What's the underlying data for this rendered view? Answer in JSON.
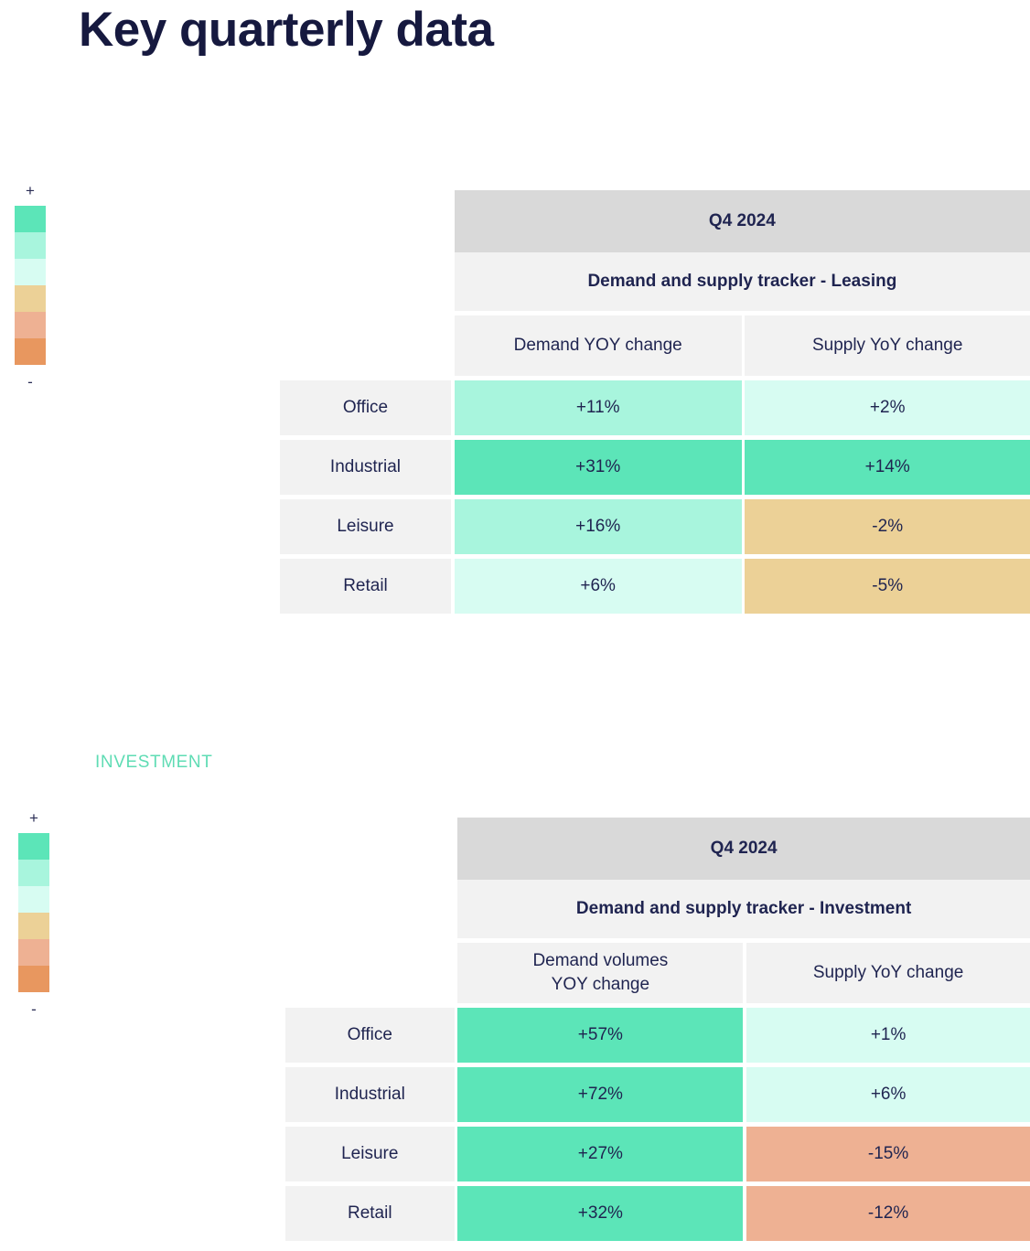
{
  "page": {
    "title": "Key quarterly data",
    "background_color": "#ffffff",
    "title_color": "#16193f"
  },
  "legend": {
    "high_label": "+",
    "low_label": "-",
    "colors": [
      "#5ce5b8",
      "#a8f5dd",
      "#d7fcf2",
      "#ecd197",
      "#eeb193",
      "#e8975f"
    ],
    "icon_plus": "plus-icon",
    "icon_minus": "minus-icon"
  },
  "sections": [
    {
      "kicker": "",
      "table": {
        "quarter": "Q4 2024",
        "subtitle": "Demand and supply tracker - Leasing",
        "column_headers": [
          "Demand YOY change",
          "Supply YoY change"
        ],
        "rows": [
          {
            "label": "Office",
            "cells": [
              {
                "value": "+11%",
                "color": "#a8f5dd"
              },
              {
                "value": "+2%",
                "color": "#d7fcf2"
              }
            ]
          },
          {
            "label": "Industrial",
            "cells": [
              {
                "value": "+31%",
                "color": "#5ce5b8"
              },
              {
                "value": "+14%",
                "color": "#5ce5b8"
              }
            ]
          },
          {
            "label": "Leisure",
            "cells": [
              {
                "value": "+16%",
                "color": "#a8f5dd"
              },
              {
                "value": "-2%",
                "color": "#ecd197"
              }
            ]
          },
          {
            "label": "Retail",
            "cells": [
              {
                "value": "+6%",
                "color": "#d7fcf2"
              },
              {
                "value": "-5%",
                "color": "#ecd197"
              }
            ]
          }
        ]
      }
    },
    {
      "kicker": "INVESTMENT",
      "kicker_color": "#5fdcb4",
      "table": {
        "quarter": "Q4 2024",
        "subtitle": "Demand and supply tracker - Investment",
        "column_headers": [
          "Demand volumes\nYOY change",
          "Supply YoY change"
        ],
        "rows": [
          {
            "label": "Office",
            "cells": [
              {
                "value": "+57%",
                "color": "#5ce5b8"
              },
              {
                "value": "+1%",
                "color": "#d7fcf2"
              }
            ]
          },
          {
            "label": "Industrial",
            "cells": [
              {
                "value": "+72%",
                "color": "#5ce5b8"
              },
              {
                "value": "+6%",
                "color": "#d7fcf2"
              }
            ]
          },
          {
            "label": "Leisure",
            "cells": [
              {
                "value": "+27%",
                "color": "#5ce5b8"
              },
              {
                "value": "-15%",
                "color": "#eeb193"
              }
            ]
          },
          {
            "label": "Retail",
            "cells": [
              {
                "value": "+32%",
                "color": "#5ce5b8"
              },
              {
                "value": "-12%",
                "color": "#eeb193"
              }
            ]
          }
        ]
      }
    }
  ],
  "chart_data": {
    "type": "heatmap",
    "title": "Key quarterly data",
    "tables": [
      {
        "title": "Demand and supply tracker - Leasing",
        "period": "Q4 2024",
        "categories": [
          "Office",
          "Industrial",
          "Leisure",
          "Retail"
        ],
        "series": [
          {
            "name": "Demand YOY change",
            "values": [
              11,
              31,
              16,
              6
            ]
          },
          {
            "name": "Supply YoY change",
            "values": [
              2,
              14,
              -2,
              -5
            ]
          }
        ],
        "units": "percent"
      },
      {
        "title": "Demand and supply tracker - Investment",
        "period": "Q4 2024",
        "categories": [
          "Office",
          "Industrial",
          "Leisure",
          "Retail"
        ],
        "series": [
          {
            "name": "Demand volumes YOY change",
            "values": [
              57,
              72,
              27,
              32
            ]
          },
          {
            "name": "Supply YoY change",
            "values": [
              1,
              6,
              -15,
              -12
            ]
          }
        ],
        "units": "percent"
      }
    ],
    "legend": {
      "position": "left",
      "scale": [
        "+",
        "-"
      ],
      "colors": [
        "#5ce5b8",
        "#a8f5dd",
        "#d7fcf2",
        "#ecd197",
        "#eeb193",
        "#e8975f"
      ]
    }
  }
}
